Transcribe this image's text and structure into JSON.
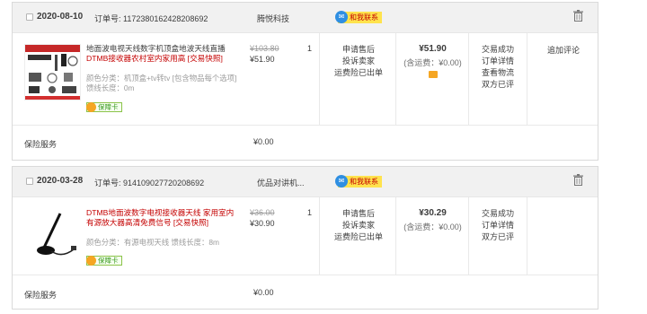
{
  "orders": [
    {
      "date": "2020-08-10",
      "order_no": "订单号: 1172380162428208692",
      "shop": "腾悦科技",
      "contact": "和我联系",
      "title_black": "地面波电视天线数字机顶盒地波天线直播",
      "title_red": "DTMB",
      "title_rest": "接收器农村室内家用高 [交易快照]",
      "spec": "颜色分类：机顶盒+tv转tv [包含物品每个选项]  馈线长度：0m",
      "badge": "保障卡",
      "price_old": "¥103.80",
      "price_new": "¥51.90",
      "qty": "1",
      "after_sale": [
        "申请售后",
        "投诉卖家",
        "运费险已出单"
      ],
      "total": "¥51.90",
      "shipping": "(含运费：¥0.00)",
      "status": [
        "交易成功",
        "订单详情",
        "查看物流",
        "双方已评"
      ],
      "review": "追加评论",
      "insurance_label": "保险服务",
      "insurance_price": "¥0.00"
    },
    {
      "date": "2020-03-28",
      "order_no": "订单号: 914109027720208692",
      "shop": "优品对讲机...",
      "contact": "和我联系",
      "title_black": "",
      "title_red": "DTMB",
      "title_rest": "地面波数字电视接收器天线 家用室内有源放大器高清免费信号 [交易快照]",
      "spec": "颜色分类：有源电视天线  馈线长度：8m",
      "badge": "保障卡",
      "price_old": "¥36.00",
      "price_new": "¥30.90",
      "qty": "1",
      "after_sale": [
        "申请售后",
        "投诉卖家",
        "运费险已出单"
      ],
      "total": "¥30.29",
      "shipping": "(含运费：¥0.00)",
      "status": [
        "交易成功",
        "订单详情",
        "双方已评"
      ],
      "review": "",
      "insurance_label": "保险服务",
      "insurance_price": "¥0.00"
    }
  ]
}
